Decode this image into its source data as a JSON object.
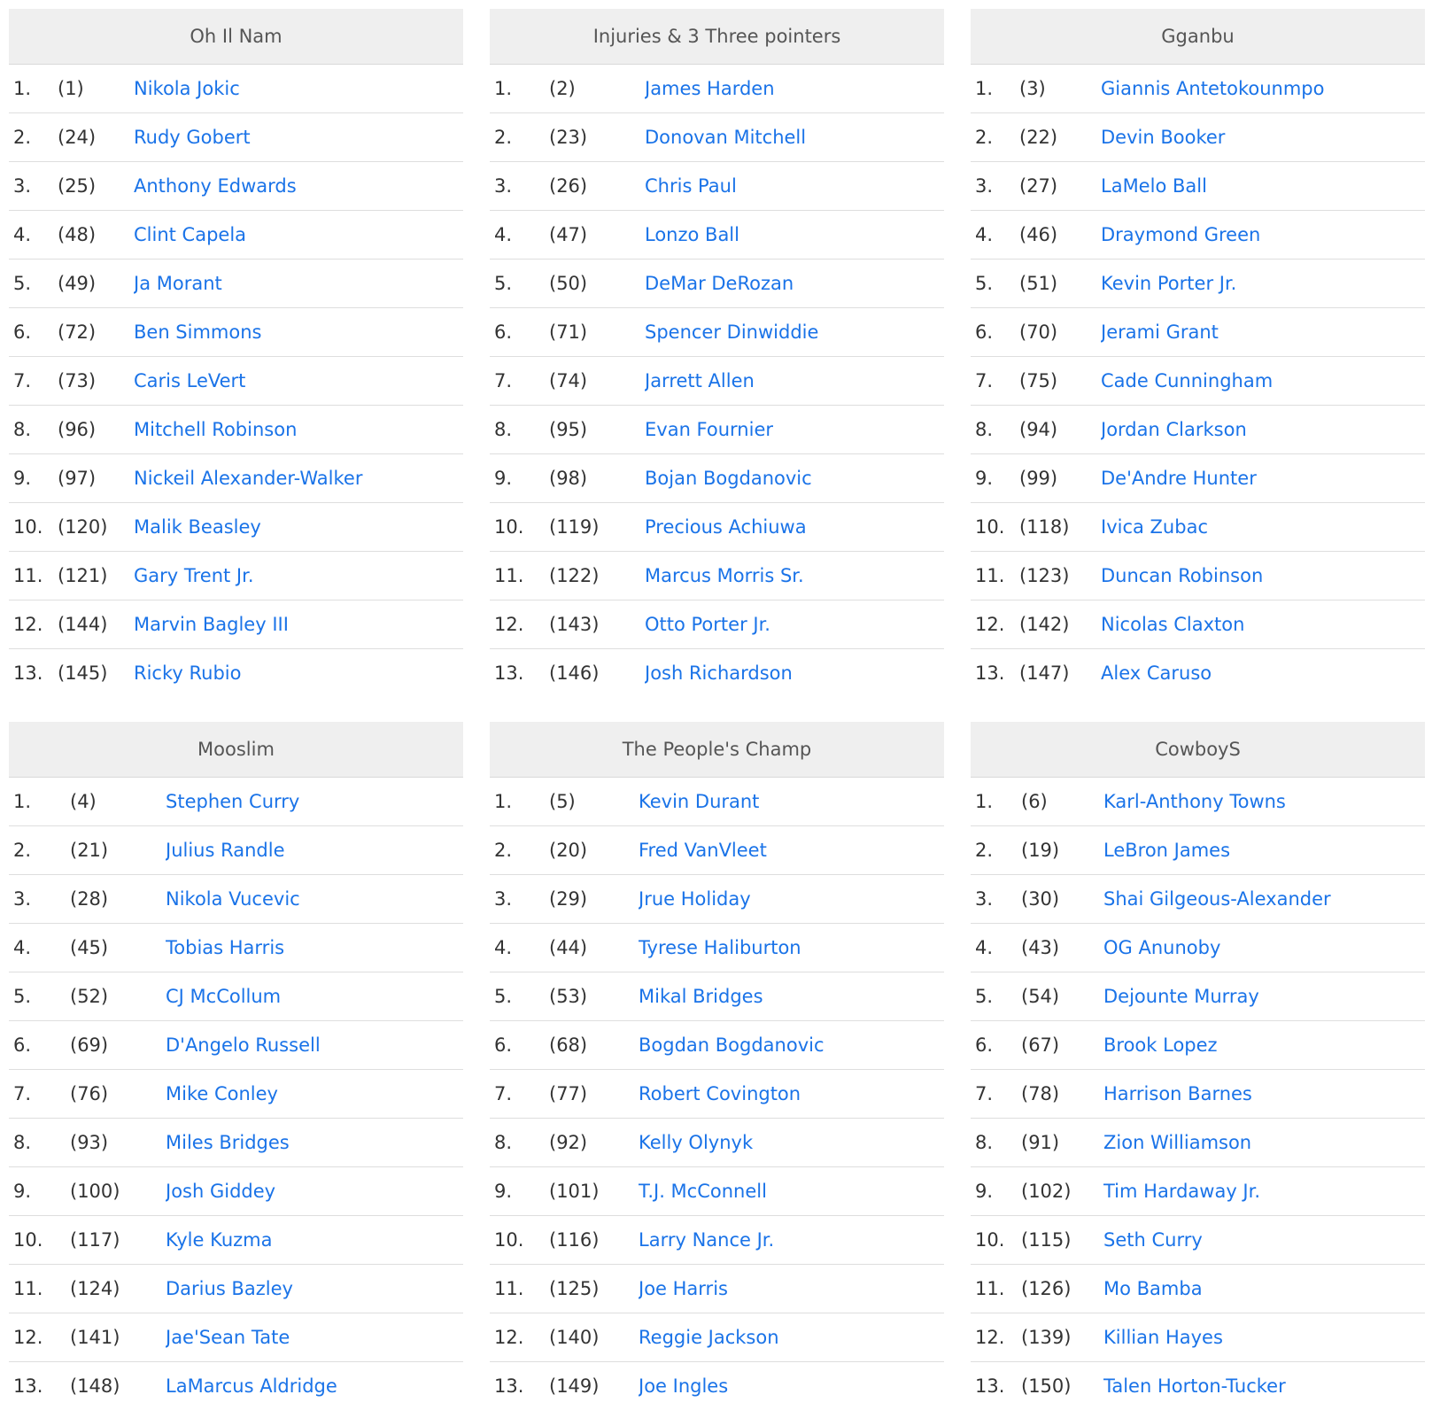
{
  "teams": [
    {
      "name": "Oh Il Nam",
      "picks": [
        {
          "round": "1.",
          "overall": "(1)",
          "player": "Nikola Jokic"
        },
        {
          "round": "2.",
          "overall": "(24)",
          "player": "Rudy Gobert"
        },
        {
          "round": "3.",
          "overall": "(25)",
          "player": "Anthony Edwards"
        },
        {
          "round": "4.",
          "overall": "(48)",
          "player": "Clint Capela"
        },
        {
          "round": "5.",
          "overall": "(49)",
          "player": "Ja Morant"
        },
        {
          "round": "6.",
          "overall": "(72)",
          "player": "Ben Simmons"
        },
        {
          "round": "7.",
          "overall": "(73)",
          "player": "Caris LeVert"
        },
        {
          "round": "8.",
          "overall": "(96)",
          "player": "Mitchell Robinson"
        },
        {
          "round": "9.",
          "overall": "(97)",
          "player": "Nickeil Alexander-Walker"
        },
        {
          "round": "10.",
          "overall": "(120)",
          "player": "Malik Beasley"
        },
        {
          "round": "11.",
          "overall": "(121)",
          "player": "Gary Trent Jr."
        },
        {
          "round": "12.",
          "overall": "(144)",
          "player": "Marvin Bagley III"
        },
        {
          "round": "13.",
          "overall": "(145)",
          "player": "Ricky Rubio"
        }
      ]
    },
    {
      "name": "Injuries & 3 Three pointers",
      "picks": [
        {
          "round": "1.",
          "overall": "(2)",
          "player": "James Harden"
        },
        {
          "round": "2.",
          "overall": "(23)",
          "player": "Donovan Mitchell"
        },
        {
          "round": "3.",
          "overall": "(26)",
          "player": "Chris Paul"
        },
        {
          "round": "4.",
          "overall": "(47)",
          "player": "Lonzo Ball"
        },
        {
          "round": "5.",
          "overall": "(50)",
          "player": "DeMar DeRozan"
        },
        {
          "round": "6.",
          "overall": "(71)",
          "player": "Spencer Dinwiddie"
        },
        {
          "round": "7.",
          "overall": "(74)",
          "player": "Jarrett Allen"
        },
        {
          "round": "8.",
          "overall": "(95)",
          "player": "Evan Fournier"
        },
        {
          "round": "9.",
          "overall": "(98)",
          "player": "Bojan Bogdanovic"
        },
        {
          "round": "10.",
          "overall": "(119)",
          "player": "Precious Achiuwa"
        },
        {
          "round": "11.",
          "overall": "(122)",
          "player": "Marcus Morris Sr."
        },
        {
          "round": "12.",
          "overall": "(143)",
          "player": "Otto Porter Jr."
        },
        {
          "round": "13.",
          "overall": "(146)",
          "player": "Josh Richardson"
        }
      ]
    },
    {
      "name": "Gganbu",
      "picks": [
        {
          "round": "1.",
          "overall": "(3)",
          "player": "Giannis Antetokounmpo"
        },
        {
          "round": "2.",
          "overall": "(22)",
          "player": "Devin Booker"
        },
        {
          "round": "3.",
          "overall": "(27)",
          "player": "LaMelo Ball"
        },
        {
          "round": "4.",
          "overall": "(46)",
          "player": "Draymond Green"
        },
        {
          "round": "5.",
          "overall": "(51)",
          "player": "Kevin Porter Jr."
        },
        {
          "round": "6.",
          "overall": "(70)",
          "player": "Jerami Grant"
        },
        {
          "round": "7.",
          "overall": "(75)",
          "player": "Cade Cunningham"
        },
        {
          "round": "8.",
          "overall": "(94)",
          "player": "Jordan Clarkson"
        },
        {
          "round": "9.",
          "overall": "(99)",
          "player": "De'Andre Hunter"
        },
        {
          "round": "10.",
          "overall": "(118)",
          "player": "Ivica Zubac"
        },
        {
          "round": "11.",
          "overall": "(123)",
          "player": "Duncan Robinson"
        },
        {
          "round": "12.",
          "overall": "(142)",
          "player": "Nicolas Claxton"
        },
        {
          "round": "13.",
          "overall": "(147)",
          "player": "Alex Caruso"
        }
      ]
    },
    {
      "name": "Mooslim",
      "picks": [
        {
          "round": "1.",
          "overall": "(4)",
          "player": "Stephen Curry"
        },
        {
          "round": "2.",
          "overall": "(21)",
          "player": "Julius Randle"
        },
        {
          "round": "3.",
          "overall": "(28)",
          "player": "Nikola Vucevic"
        },
        {
          "round": "4.",
          "overall": "(45)",
          "player": "Tobias Harris"
        },
        {
          "round": "5.",
          "overall": "(52)",
          "player": "CJ McCollum"
        },
        {
          "round": "6.",
          "overall": "(69)",
          "player": "D'Angelo Russell"
        },
        {
          "round": "7.",
          "overall": "(76)",
          "player": "Mike Conley"
        },
        {
          "round": "8.",
          "overall": "(93)",
          "player": "Miles Bridges"
        },
        {
          "round": "9.",
          "overall": "(100)",
          "player": "Josh Giddey"
        },
        {
          "round": "10.",
          "overall": "(117)",
          "player": "Kyle Kuzma"
        },
        {
          "round": "11.",
          "overall": "(124)",
          "player": "Darius Bazley"
        },
        {
          "round": "12.",
          "overall": "(141)",
          "player": "Jae'Sean Tate"
        },
        {
          "round": "13.",
          "overall": "(148)",
          "player": "LaMarcus Aldridge"
        }
      ]
    },
    {
      "name": "The People's Champ",
      "picks": [
        {
          "round": "1.",
          "overall": "(5)",
          "player": "Kevin Durant"
        },
        {
          "round": "2.",
          "overall": "(20)",
          "player": "Fred VanVleet"
        },
        {
          "round": "3.",
          "overall": "(29)",
          "player": "Jrue Holiday"
        },
        {
          "round": "4.",
          "overall": "(44)",
          "player": "Tyrese Haliburton"
        },
        {
          "round": "5.",
          "overall": "(53)",
          "player": "Mikal Bridges"
        },
        {
          "round": "6.",
          "overall": "(68)",
          "player": "Bogdan Bogdanovic"
        },
        {
          "round": "7.",
          "overall": "(77)",
          "player": "Robert Covington"
        },
        {
          "round": "8.",
          "overall": "(92)",
          "player": "Kelly Olynyk"
        },
        {
          "round": "9.",
          "overall": "(101)",
          "player": "T.J. McConnell"
        },
        {
          "round": "10.",
          "overall": "(116)",
          "player": "Larry Nance Jr."
        },
        {
          "round": "11.",
          "overall": "(125)",
          "player": "Joe Harris"
        },
        {
          "round": "12.",
          "overall": "(140)",
          "player": "Reggie Jackson"
        },
        {
          "round": "13.",
          "overall": "(149)",
          "player": "Joe Ingles"
        }
      ]
    },
    {
      "name": "CowboyS",
      "picks": [
        {
          "round": "1.",
          "overall": "(6)",
          "player": "Karl-Anthony Towns"
        },
        {
          "round": "2.",
          "overall": "(19)",
          "player": "LeBron James"
        },
        {
          "round": "3.",
          "overall": "(30)",
          "player": "Shai Gilgeous-Alexander"
        },
        {
          "round": "4.",
          "overall": "(43)",
          "player": "OG Anunoby"
        },
        {
          "round": "5.",
          "overall": "(54)",
          "player": "Dejounte Murray"
        },
        {
          "round": "6.",
          "overall": "(67)",
          "player": "Brook Lopez"
        },
        {
          "round": "7.",
          "overall": "(78)",
          "player": "Harrison Barnes"
        },
        {
          "round": "8.",
          "overall": "(91)",
          "player": "Zion Williamson"
        },
        {
          "round": "9.",
          "overall": "(102)",
          "player": "Tim Hardaway Jr."
        },
        {
          "round": "10.",
          "overall": "(115)",
          "player": "Seth Curry"
        },
        {
          "round": "11.",
          "overall": "(126)",
          "player": "Mo Bamba"
        },
        {
          "round": "12.",
          "overall": "(139)",
          "player": "Killian Hayes"
        },
        {
          "round": "13.",
          "overall": "(150)",
          "player": "Talen Horton-Tucker"
        }
      ]
    }
  ]
}
